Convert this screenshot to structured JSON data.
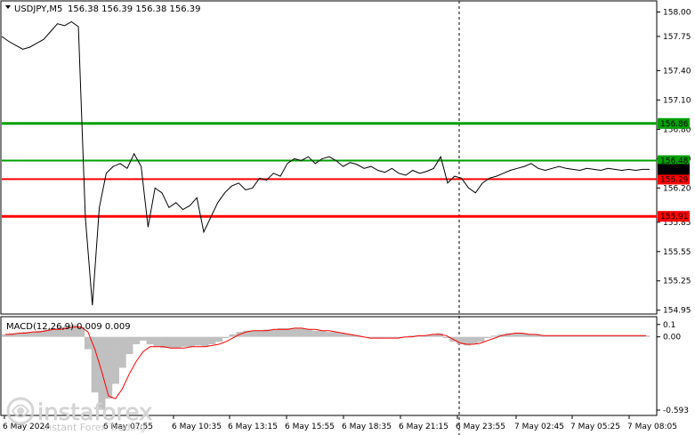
{
  "header": {
    "symbol_label": "USDJPY,M5",
    "ohlc": "156.38 156.39 156.38 156.39"
  },
  "indicator": {
    "label": "MACD(12,26,9) 0.009 0.009"
  },
  "watermark": {
    "brand": "instaforex",
    "tagline": "Instant Forex Trading"
  },
  "colors": {
    "price_line": "#000000",
    "green_level": "#00a000",
    "red_level": "#ff0000",
    "histogram": "#c0c0c0",
    "signal_line": "#ff0000",
    "current_price_box": "#000000"
  },
  "chart_data": [
    {
      "type": "line",
      "title": "USDJPY,M5",
      "y_axis_ticks": [
        "158.00",
        "157.75",
        "157.40",
        "157.10",
        "156.80",
        "156.50",
        "156.20",
        "155.85",
        "155.55",
        "155.25",
        "154.95"
      ],
      "ylim": [
        154.92,
        158.05
      ],
      "x_tick_labels": [
        "6 May 2024",
        "6 May 07:55",
        "6 May 10:35",
        "6 May 13:15",
        "6 May 15:55",
        "6 May 18:35",
        "6 May 21:15",
        "6 May 23:55",
        "7 May 02:45",
        "7 May 05:25",
        "7 May 08:05"
      ],
      "series": [
        {
          "name": "USDJPY",
          "x": [
            0,
            1,
            2,
            3,
            4,
            5,
            6,
            7,
            8,
            9,
            10,
            11,
            12,
            13,
            14,
            15,
            16,
            17,
            18,
            19,
            20,
            21,
            22,
            23,
            24,
            25,
            26,
            27,
            28,
            29,
            30,
            31,
            32,
            33,
            34,
            35,
            36,
            37,
            38,
            39,
            40,
            41,
            42,
            43,
            44,
            45,
            46,
            47,
            48,
            49,
            50,
            51,
            52,
            53,
            54,
            55,
            56,
            57,
            58,
            59,
            60,
            61,
            62,
            63,
            64,
            65,
            66,
            67,
            68,
            69,
            70,
            71,
            72,
            73,
            74,
            75,
            76,
            77,
            78,
            79,
            80,
            81,
            82,
            83,
            84,
            85,
            86,
            87,
            88,
            89,
            90,
            91,
            92,
            93
          ],
          "values": [
            157.75,
            157.7,
            157.66,
            157.62,
            157.64,
            157.68,
            157.72,
            157.8,
            157.88,
            157.86,
            157.9,
            157.85,
            155.9,
            155.0,
            156.0,
            156.35,
            156.42,
            156.45,
            156.4,
            156.55,
            156.42,
            155.8,
            156.2,
            156.15,
            156.0,
            156.05,
            155.98,
            156.02,
            156.1,
            155.75,
            155.9,
            156.05,
            156.15,
            156.22,
            156.25,
            156.18,
            156.2,
            156.3,
            156.28,
            156.35,
            156.32,
            156.45,
            156.5,
            156.48,
            156.52,
            156.45,
            156.5,
            156.52,
            156.48,
            156.42,
            156.46,
            156.44,
            156.4,
            156.42,
            156.38,
            156.36,
            156.4,
            156.35,
            156.33,
            156.38,
            156.35,
            156.37,
            156.4,
            156.52,
            156.25,
            156.32,
            156.3,
            156.2,
            156.15,
            156.25,
            156.3,
            156.32,
            156.35,
            156.38,
            156.4,
            156.42,
            156.45,
            156.4,
            156.38,
            156.4,
            156.42,
            156.4,
            156.39,
            156.38,
            156.4,
            156.39,
            156.38,
            156.4,
            156.39,
            156.38,
            156.39,
            156.38,
            156.39,
            156.39
          ]
        }
      ],
      "levels": [
        {
          "value": 156.86,
          "label": "156.86",
          "color": "#00a000"
        },
        {
          "value": 156.48,
          "label": "156.48",
          "color": "#00a000"
        },
        {
          "value": 156.29,
          "label": "156.29",
          "color": "#ff0000"
        },
        {
          "value": 155.91,
          "label": "155.91",
          "color": "#ff0000"
        }
      ],
      "current_price": {
        "value": 156.39,
        "label": "156.39"
      },
      "grid": false
    },
    {
      "type": "bar",
      "title": "MACD(12,26,9) 0.009 0.009",
      "y_axis_ticks": [
        "0.1",
        "0.00",
        "-0.593"
      ],
      "ylim": [
        -0.6,
        0.12
      ],
      "histogram": [
        0.02,
        0.03,
        0.03,
        0.04,
        0.04,
        0.05,
        0.06,
        0.07,
        0.08,
        0.09,
        0.1,
        0.08,
        -0.1,
        -0.45,
        -0.59,
        -0.5,
        -0.38,
        -0.25,
        -0.14,
        -0.06,
        -0.03,
        -0.06,
        -0.08,
        -0.09,
        -0.09,
        -0.09,
        -0.08,
        -0.08,
        -0.07,
        -0.08,
        -0.06,
        -0.04,
        -0.01,
        0.02,
        0.04,
        0.05,
        0.05,
        0.05,
        0.06,
        0.06,
        0.07,
        0.07,
        0.07,
        0.07,
        0.06,
        0.05,
        0.05,
        0.04,
        0.04,
        0.03,
        0.02,
        0.01,
        0.0,
        -0.01,
        -0.01,
        -0.01,
        -0.01,
        -0.01,
        0.0,
        0.01,
        0.01,
        0.01,
        0.02,
        0.03,
        -0.01,
        -0.04,
        -0.06,
        -0.07,
        -0.06,
        -0.04,
        -0.01,
        0.01,
        0.02,
        0.03,
        0.03,
        0.03,
        0.02,
        0.02,
        0.01,
        0.01,
        0.01,
        0.01,
        0.01,
        0.01,
        0.01,
        0.01,
        0.01,
        0.01,
        0.01,
        0.01,
        0.01,
        0.01,
        0.01,
        0.01
      ],
      "signal": [
        0.02,
        0.02,
        0.03,
        0.03,
        0.04,
        0.04,
        0.05,
        0.06,
        0.06,
        0.07,
        0.08,
        0.08,
        0.04,
        -0.1,
        -0.28,
        -0.48,
        -0.5,
        -0.42,
        -0.3,
        -0.2,
        -0.12,
        -0.08,
        -0.08,
        -0.08,
        -0.09,
        -0.09,
        -0.09,
        -0.08,
        -0.08,
        -0.08,
        -0.07,
        -0.06,
        -0.04,
        -0.01,
        0.02,
        0.04,
        0.05,
        0.05,
        0.05,
        0.06,
        0.06,
        0.06,
        0.07,
        0.07,
        0.06,
        0.06,
        0.05,
        0.05,
        0.04,
        0.03,
        0.02,
        0.01,
        0.0,
        -0.01,
        -0.01,
        -0.01,
        -0.01,
        -0.01,
        0.0,
        0.0,
        0.01,
        0.01,
        0.02,
        0.02,
        0.01,
        -0.02,
        -0.05,
        -0.06,
        -0.06,
        -0.05,
        -0.03,
        -0.01,
        0.01,
        0.02,
        0.03,
        0.03,
        0.02,
        0.02,
        0.01,
        0.01,
        0.01,
        0.01,
        0.01,
        0.01,
        0.01,
        0.01,
        0.01,
        0.01,
        0.01,
        0.01,
        0.01,
        0.01,
        0.01,
        0.01
      ]
    }
  ]
}
